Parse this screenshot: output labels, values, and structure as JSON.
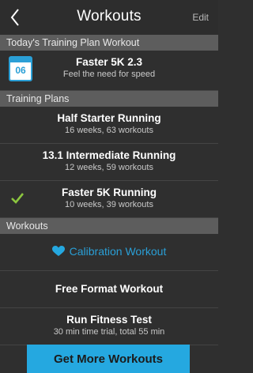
{
  "nav": {
    "title": "Workouts",
    "edit_label": "Edit"
  },
  "today": {
    "section_label": "Today's Training Plan Workout",
    "calendar_day": "06",
    "title": "Faster 5K 2.3",
    "subtitle": "Feel the need for speed"
  },
  "plans": {
    "section_label": "Training Plans",
    "items": [
      {
        "title": "Half Starter Running",
        "subtitle": "16 weeks, 63 workouts"
      },
      {
        "title": "13.1 Intermediate Running",
        "subtitle": "12 weeks, 59 workouts"
      },
      {
        "title": "Faster 5K Running",
        "subtitle": "10 weeks, 39 workouts",
        "selected": true
      }
    ]
  },
  "workouts": {
    "section_label": "Workouts",
    "calibration": "Calibration Workout",
    "free_format": "Free Format Workout",
    "fitness_test": {
      "title": "Run Fitness Test",
      "subtitle": "30 min time trial, total 55 min"
    }
  },
  "cta": {
    "label": "Get More Workouts"
  },
  "colors": {
    "accent": "#25a8e0",
    "check": "#8cc63f"
  },
  "icons": {
    "back": "chevron-left-icon",
    "calendar": "calendar-icon",
    "check": "checkmark-icon",
    "heart": "heart-icon"
  }
}
